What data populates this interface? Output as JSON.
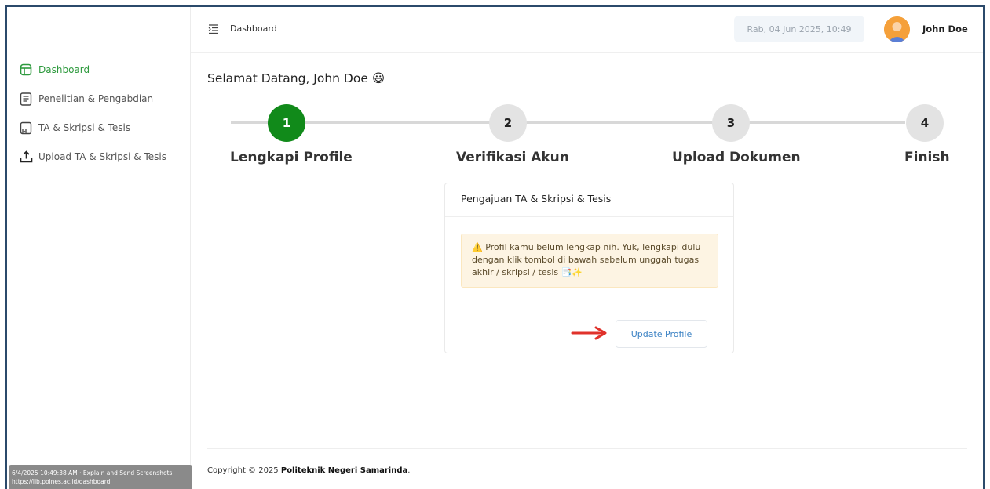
{
  "topbar": {
    "title": "Dashboard",
    "datetime": "Rab, 04 Jun 2025, 10:49",
    "user_name": "John Doe"
  },
  "sidebar": {
    "items": [
      {
        "label": "Dashboard",
        "icon": "dashboard-icon",
        "active": true
      },
      {
        "label": "Penelitian & Pengabdian",
        "icon": "document-icon",
        "active": false
      },
      {
        "label": "TA & Skripsi & Tesis",
        "icon": "thesis-icon",
        "active": false
      },
      {
        "label": "Upload TA & Skripsi & Tesis",
        "icon": "upload-icon",
        "active": false
      }
    ],
    "overlay_line1": "6/4/2025 10:49:38 AM · Explain and Send Screenshots",
    "overlay_line2": "https://lib.polnes.ac.id/dashboard"
  },
  "main": {
    "welcome": "Selamat Datang, John Doe 😃",
    "steps": [
      {
        "number": "1",
        "label": "Lengkapi Profile",
        "active": true
      },
      {
        "number": "2",
        "label": "Verifikasi Akun",
        "active": false
      },
      {
        "number": "3",
        "label": "Upload Dokumen",
        "active": false
      },
      {
        "number": "4",
        "label": "Finish",
        "active": false
      }
    ],
    "card": {
      "title": "Pengajuan TA & Skripsi & Tesis",
      "alert_text": "⚠️ Profil kamu belum lengkap nih. Yuk, lengkapi dulu dengan klik tombol di bawah sebelum unggah tugas akhir / skripsi / tesis 📑✨",
      "button_label": "Update Profile"
    }
  },
  "footer": {
    "copyright_prefix": "Copyright © 2025 ",
    "institution": "Politeknik Negeri Samarinda",
    "suffix": "."
  },
  "colors": {
    "accent_green": "#2e9a3e",
    "step_active": "#118a1a",
    "button_text": "#3b82c4",
    "arrow": "#e0322b",
    "frame_border": "#2b4a6b"
  }
}
